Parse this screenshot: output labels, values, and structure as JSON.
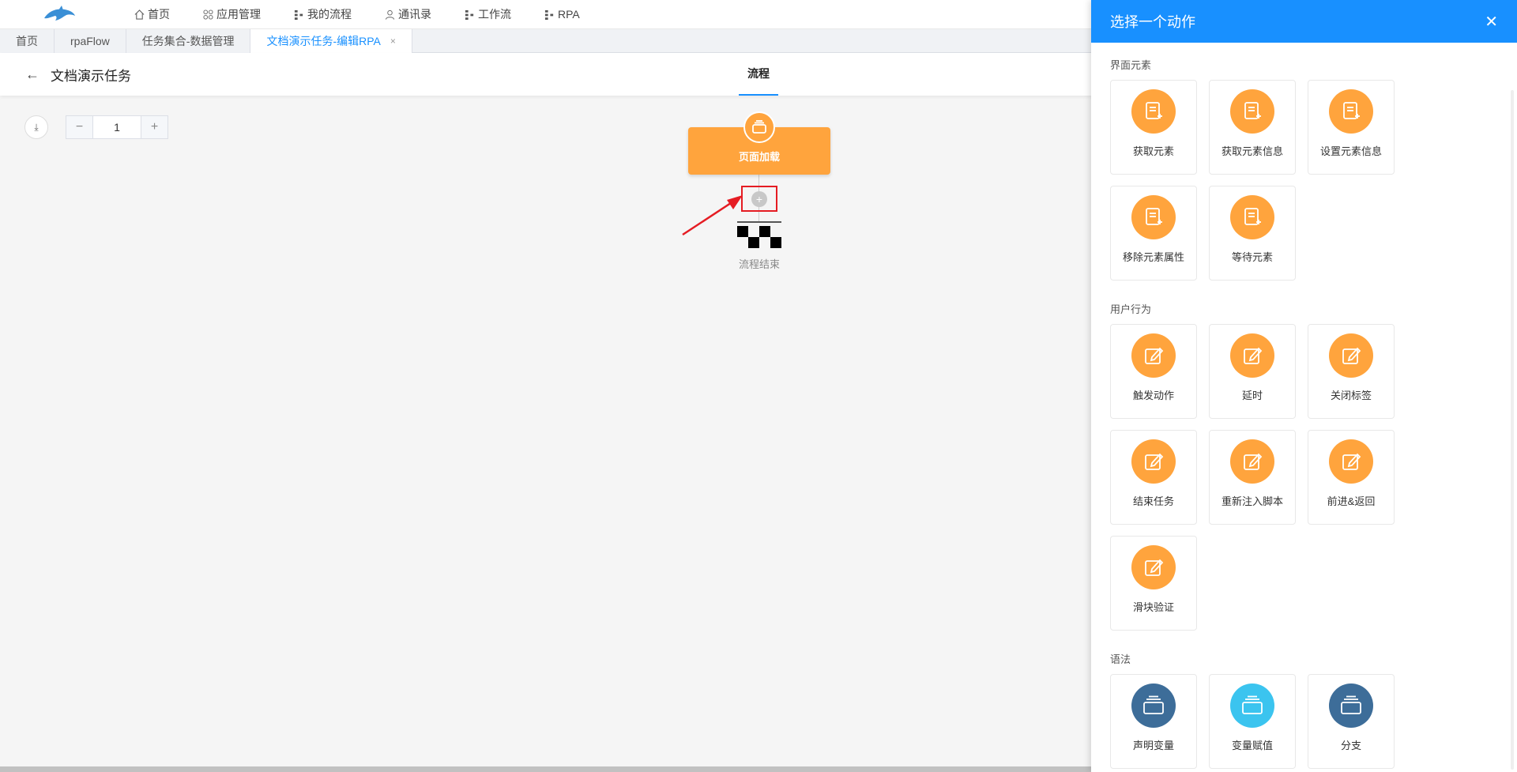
{
  "nav": {
    "items": [
      {
        "label": "首页",
        "icon": "home-icon"
      },
      {
        "label": "应用管理",
        "icon": "apps-icon"
      },
      {
        "label": "我的流程",
        "icon": "flow-icon"
      },
      {
        "label": "通讯录",
        "icon": "user-icon"
      },
      {
        "label": "工作流",
        "icon": "flow-icon"
      },
      {
        "label": "RPA",
        "icon": "flow-icon"
      }
    ]
  },
  "tabs": [
    {
      "label": "首页"
    },
    {
      "label": "rpaFlow"
    },
    {
      "label": "任务集合-数据管理"
    },
    {
      "label": "文档演示任务-编辑RPA",
      "close": "×"
    }
  ],
  "header": {
    "back": "←",
    "title": "文档演示任务",
    "flow_tab": "流程"
  },
  "canvas": {
    "download": "⤓",
    "zoom_minus": "−",
    "zoom_value": "1",
    "zoom_plus": "+",
    "node_label": "页面加载",
    "plus": "+",
    "end_label": "流程结束"
  },
  "drawer": {
    "title": "选择一个动作",
    "close": "✕",
    "sections": [
      {
        "title": "界面元素",
        "items": [
          {
            "label": "获取元素",
            "icon": "doc-add-icon"
          },
          {
            "label": "获取元素信息",
            "icon": "doc-add-icon"
          },
          {
            "label": "设置元素信息",
            "icon": "doc-add-icon"
          },
          {
            "label": "移除元素属性",
            "icon": "doc-add-icon"
          },
          {
            "label": "等待元素",
            "icon": "doc-add-icon"
          }
        ]
      },
      {
        "title": "用户行为",
        "items": [
          {
            "label": "触发动作",
            "icon": "edit-icon"
          },
          {
            "label": "延时",
            "icon": "edit-icon"
          },
          {
            "label": "关闭标签",
            "icon": "edit-icon"
          },
          {
            "label": "结束任务",
            "icon": "edit-icon"
          },
          {
            "label": "重新注入脚本",
            "icon": "edit-icon"
          },
          {
            "label": "前进&返回",
            "icon": "edit-icon"
          },
          {
            "label": "滑块验证",
            "icon": "edit-icon"
          }
        ]
      },
      {
        "title": "语法",
        "items": [
          {
            "label": "声明变量",
            "icon": "stack-icon",
            "color": "#3d6d99"
          },
          {
            "label": "变量赋值",
            "icon": "stack-icon",
            "color": "#3bc4ef"
          },
          {
            "label": "分支",
            "icon": "stack-icon",
            "color": "#3d6d99"
          }
        ]
      }
    ]
  },
  "colors": {
    "accent": "#1890ff",
    "orange": "#ffa43d",
    "highlight": "#e51c23"
  }
}
